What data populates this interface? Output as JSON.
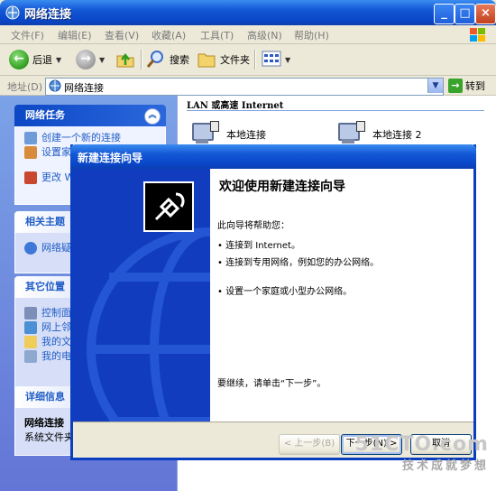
{
  "window": {
    "title": "网络连接"
  },
  "menu": [
    "文件(F)",
    "编辑(E)",
    "查看(V)",
    "收藏(A)",
    "工具(T)",
    "高级(N)",
    "帮助(H)"
  ],
  "toolbar": {
    "back": "后退",
    "search": "搜索",
    "folders": "文件夹"
  },
  "address": {
    "label": "地址(D)",
    "value": "网络连接",
    "go": "转到"
  },
  "left": {
    "network_tasks": {
      "title": "网络任务",
      "items": [
        "创建一个新的连接",
        "设置家庭或小型办公网络",
        "更改 Windows 防火墙设置"
      ]
    },
    "related": {
      "title": "相关主题",
      "items": [
        "网络疑难解答程序"
      ]
    },
    "other": {
      "title": "其它位置",
      "items": [
        "控制面板",
        "网上邻居",
        "我的文档",
        "我的电脑"
      ]
    },
    "details": {
      "title": "详细信息",
      "name": "网络连接",
      "desc": "系统文件夹"
    }
  },
  "content": {
    "group": "LAN 或高速 Internet",
    "connections": [
      "本地连接",
      "本地连接 2"
    ]
  },
  "wizard": {
    "title": "新建连接向导",
    "heading": "欢迎使用新建连接向导",
    "intro": "此向导将帮助您：",
    "bullets": [
      "• 连接到 Internet。",
      "• 连接到专用网络，例如您的办公网络。",
      "• 设置一个家庭或小型办公网络。"
    ],
    "cont": "要继续，请单击“下一步”。",
    "back": "< 上一步(B)",
    "next": "下一步(N) >",
    "cancel": "取消"
  },
  "watermark": {
    "site": "51CTO.com",
    "slogan": "技术成就梦想"
  },
  "colors": {
    "xp_blue": "#0a47c8",
    "wizard_left": "#103cbd",
    "link": "#215dc6"
  }
}
